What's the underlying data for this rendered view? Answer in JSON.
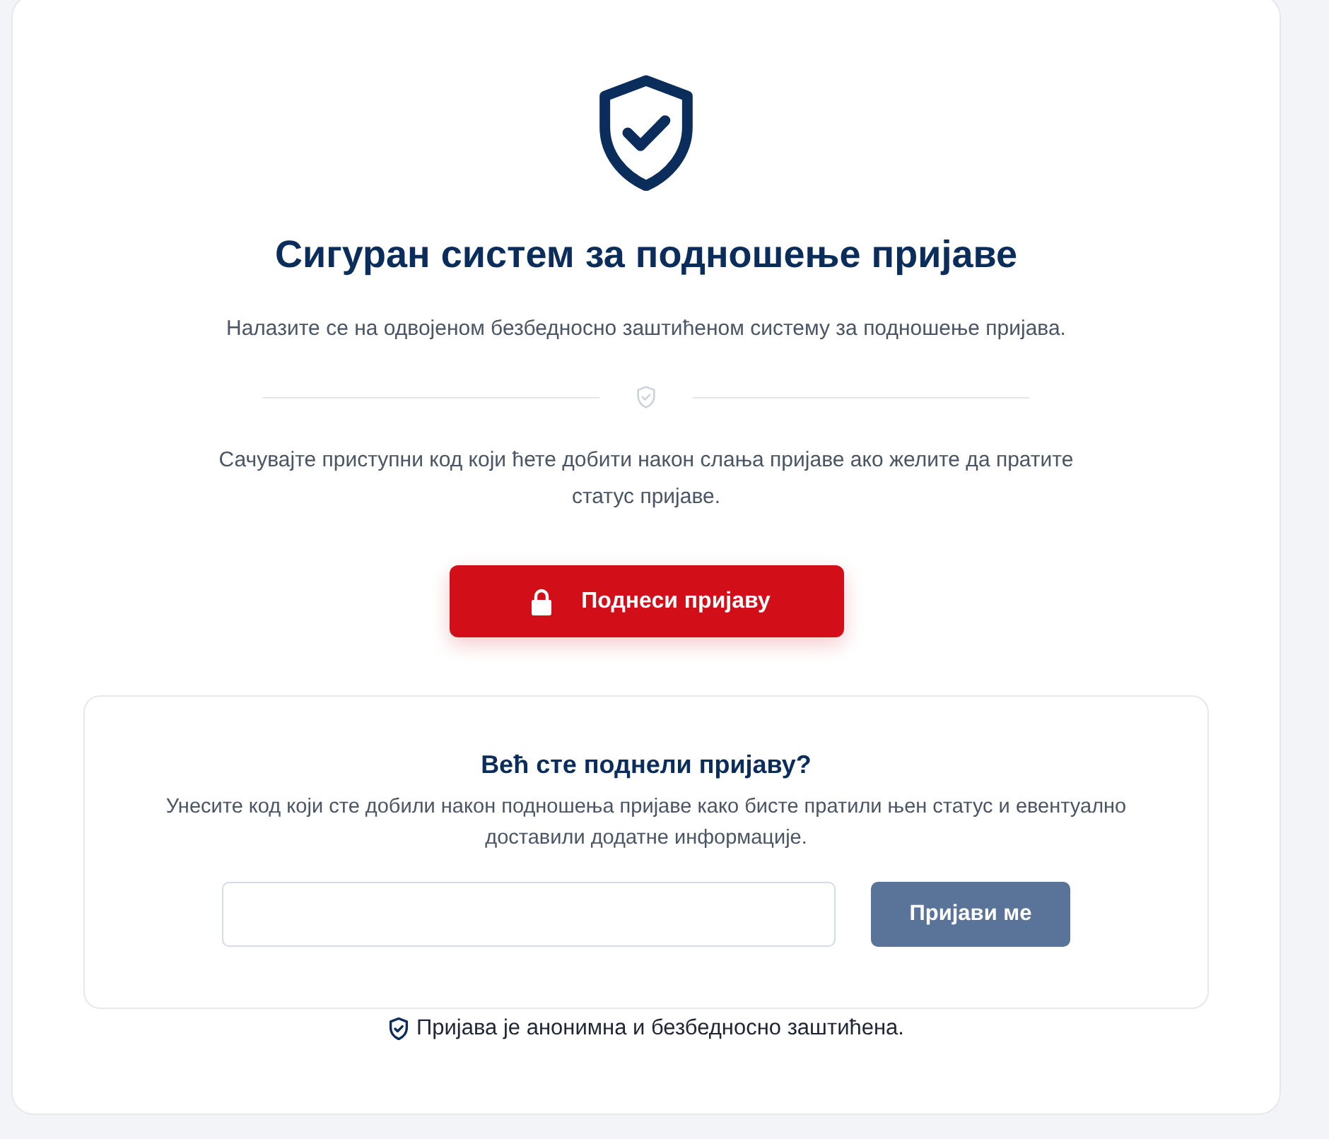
{
  "header": {
    "title": "Сигуран систем за подношење пријаве",
    "subtitle": "Налазите се на одвојеном безбедносно заштићеном систему за подношење пријава."
  },
  "notice": "Сачувајте приступни код који ћете добити након слања пријаве ако желите да пратите статус пријаве.",
  "submit_button": {
    "label": "Поднеси пријаву"
  },
  "login_panel": {
    "title": "Већ сте поднели пријаву?",
    "description": "Унесите код који сте добили након подношења пријаве како бисте пратили њен статус и евентуално доставили додатне информације.",
    "login_button": {
      "label": "Пријави ме",
      "disabled": true
    }
  },
  "footer_note": "Пријава је анонимна и безбедносно заштићена."
}
